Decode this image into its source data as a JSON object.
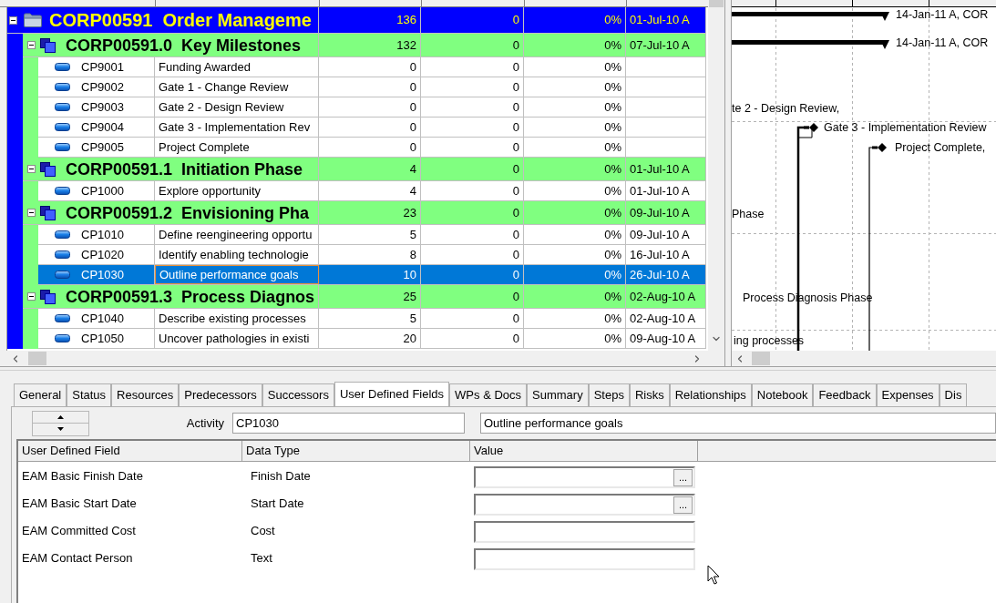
{
  "activity_grid": {
    "rows": [
      {
        "kind": "project",
        "expanded": true,
        "selected": false,
        "label": "CORP00591  Order Manageme",
        "column_3": "136",
        "column_4": "0",
        "column_5": "0%",
        "column_6": "01-Jul-10 A",
        "children": [
          {
            "kind": "wbs",
            "expanded": true,
            "selected": false,
            "label": "CORP00591.0  Key Milestones",
            "column_3": "132",
            "column_4": "0",
            "column_5": "0%",
            "column_6": "07-Jul-10 A",
            "children": [
              {
                "kind": "activity",
                "selected": false,
                "id": "CP9001",
                "name": "Funding Awarded",
                "column_3": "0",
                "column_4": "0",
                "column_5": "0%"
              },
              {
                "kind": "activity",
                "selected": false,
                "id": "CP9002",
                "name": "Gate 1 - Change Review",
                "column_3": "0",
                "column_4": "0",
                "column_5": "0%"
              },
              {
                "kind": "activity",
                "selected": false,
                "id": "CP9003",
                "name": "Gate 2 - Design Review",
                "column_3": "0",
                "column_4": "0",
                "column_5": "0%"
              },
              {
                "kind": "activity",
                "selected": false,
                "id": "CP9004",
                "name": "Gate 3 - Implementation Rev",
                "column_3": "0",
                "column_4": "0",
                "column_5": "0%"
              },
              {
                "kind": "activity",
                "selected": false,
                "id": "CP9005",
                "name": "Project Complete",
                "column_3": "0",
                "column_4": "0",
                "column_5": "0%"
              }
            ]
          },
          {
            "kind": "wbs",
            "expanded": true,
            "selected": false,
            "label": "CORP00591.1  Initiation Phase",
            "column_3": "4",
            "column_4": "0",
            "column_5": "0%",
            "column_6": "01-Jul-10 A",
            "children": [
              {
                "kind": "activity",
                "selected": false,
                "id": "CP1000",
                "name": "Explore opportunity",
                "column_3": "4",
                "column_4": "0",
                "column_5": "0%",
                "column_6": "01-Jul-10 A"
              }
            ]
          },
          {
            "kind": "wbs",
            "expanded": true,
            "selected": false,
            "label": "CORP00591.2  Envisioning Pha",
            "column_3": "23",
            "column_4": "0",
            "column_5": "0%",
            "column_6": "09-Jul-10 A",
            "children": [
              {
                "kind": "activity",
                "selected": false,
                "id": "CP1010",
                "name": "Define reengineering opportu",
                "column_3": "5",
                "column_4": "0",
                "column_5": "0%",
                "column_6": "09-Jul-10 A"
              },
              {
                "kind": "activity",
                "selected": false,
                "id": "CP1020",
                "name": "Identify enabling technologie",
                "column_3": "8",
                "column_4": "0",
                "column_5": "0%",
                "column_6": "16-Jul-10 A"
              },
              {
                "kind": "activity",
                "selected": true,
                "id": "CP1030",
                "name": "Outline performance goals",
                "column_3": "10",
                "column_4": "0",
                "column_5": "0%",
                "column_6": "26-Jul-10 A"
              }
            ]
          },
          {
            "kind": "wbs",
            "expanded": true,
            "selected": false,
            "label": "CORP00591.3  Process Diagnos",
            "column_3": "25",
            "column_4": "0",
            "column_5": "0%",
            "column_6": "02-Aug-10 A",
            "children": [
              {
                "kind": "activity",
                "selected": false,
                "id": "CP1040",
                "name": "Describe existing processes",
                "column_3": "5",
                "column_4": "0",
                "column_5": "0%",
                "column_6": "02-Aug-10 A"
              },
              {
                "kind": "activity",
                "selected": false,
                "id": "CP1050",
                "name": "Uncover pathologies in existi",
                "column_3": "20",
                "column_4": "0",
                "column_5": "0%",
                "column_6": "09-Aug-10 A"
              }
            ]
          }
        ]
      }
    ]
  },
  "gantt": {
    "labels": [
      {
        "kind": "summary",
        "text": "14-Jan-11 A, COR"
      },
      {
        "kind": "summary",
        "text": "14-Jan-11 A, COR"
      },
      {
        "kind": "note",
        "text": "te 2 - Design Review,"
      },
      {
        "kind": "milestone",
        "text": "Gate 3 - Implementation Review"
      },
      {
        "kind": "milestone",
        "text": "Project Complete,"
      },
      {
        "kind": "note",
        "text": "Phase"
      },
      {
        "kind": "note",
        "text": "Process Diagnosis Phase"
      },
      {
        "kind": "note",
        "text": "ing processes"
      }
    ]
  },
  "details": {
    "tabs": [
      {
        "label": "General",
        "selected": false
      },
      {
        "label": "Status",
        "selected": false
      },
      {
        "label": "Resources",
        "selected": false
      },
      {
        "label": "Predecessors",
        "selected": false
      },
      {
        "label": "Successors",
        "selected": false
      },
      {
        "label": "User Defined Fields",
        "selected": true
      },
      {
        "label": "WPs & Docs",
        "selected": false
      },
      {
        "label": "Summary",
        "selected": false
      },
      {
        "label": "Steps",
        "selected": false
      },
      {
        "label": "Risks",
        "selected": false
      },
      {
        "label": "Relationships",
        "selected": false
      },
      {
        "label": "Notebook",
        "selected": false
      },
      {
        "label": "Feedback",
        "selected": false
      },
      {
        "label": "Expenses",
        "selected": false
      },
      {
        "label": "Dis",
        "selected": false
      }
    ],
    "activity": {
      "label": "Activity",
      "id_value": "CP1030",
      "name_value": "Outline performance goals"
    },
    "udf_table": {
      "columns": [
        "User Defined Field",
        "Data Type",
        "Value"
      ],
      "rows": [
        {
          "kind": "date",
          "field": "EAM Basic Finish Date",
          "data_type": "Finish Date",
          "button": "..."
        },
        {
          "kind": "date",
          "field": "EAM Basic Start Date",
          "data_type": "Start Date",
          "button": "..."
        },
        {
          "kind": "text",
          "field": "EAM Committed Cost",
          "data_type": "Cost"
        },
        {
          "kind": "text",
          "field": "EAM Contact Person",
          "data_type": "Text"
        }
      ]
    }
  }
}
